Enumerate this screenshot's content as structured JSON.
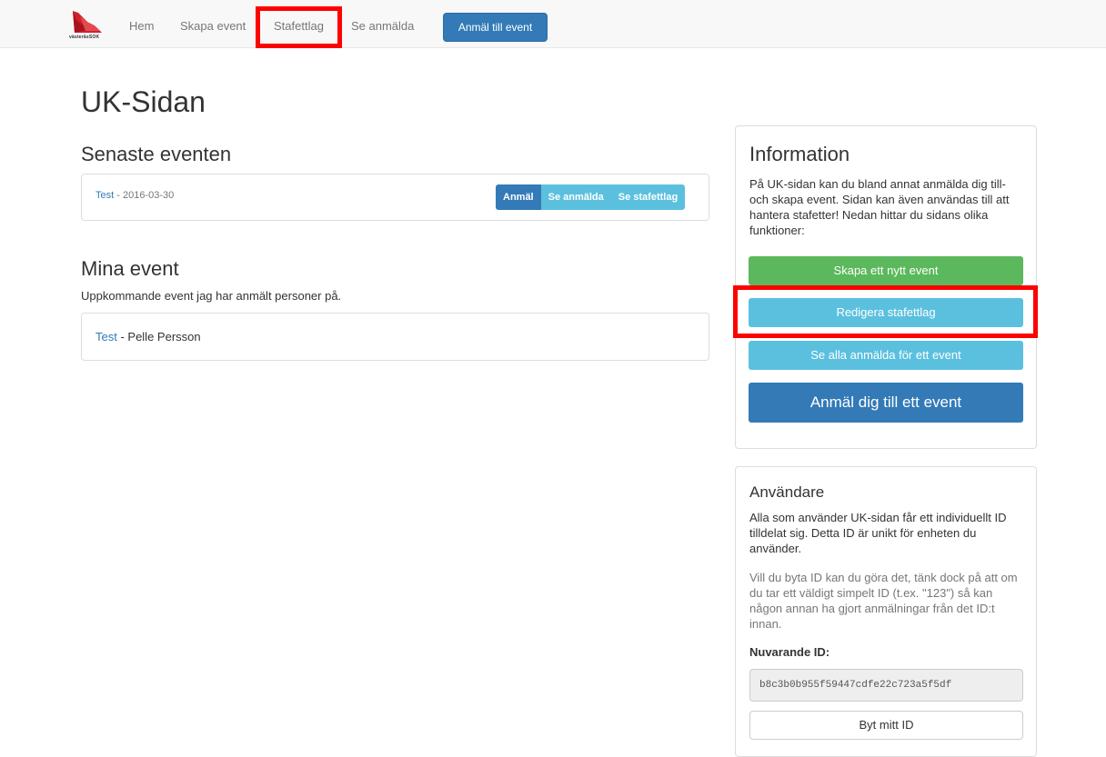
{
  "nav": {
    "logo_text": "västeråsSOK",
    "links": [
      "Hem",
      "Skapa event",
      "Stafettlag",
      "Se anmälda"
    ],
    "cta_label": "Anmäl till event"
  },
  "page_title": "UK-Sidan",
  "latest": {
    "heading": "Senaste eventen",
    "event_name": "Test",
    "event_date": " - 2016-03-30",
    "buttons": [
      "Anmäl",
      "Se anmälda",
      "Se stafettlag"
    ]
  },
  "my_events": {
    "heading": "Mina event",
    "description": "Uppkommande event jag har anmält personer på.",
    "item_link": "Test",
    "item_rest": " - Pelle Persson"
  },
  "info": {
    "heading": "Information",
    "text": "På UK-sidan kan du bland annat anmälda dig till- och skapa event. Sidan kan även användas till att hantera stafetter! Nedan hittar du sidans olika funktioner:",
    "btn_create": "Skapa ett nytt event",
    "btn_edit_relay": "Redigera stafettlag",
    "btn_see_all": "Se alla anmälda för ett event",
    "btn_register": "Anmäl dig till ett event"
  },
  "user": {
    "heading": "Användare",
    "text1": "Alla som använder UK-sidan får ett individuellt ID tilldelat sig. Detta ID är unikt för enheten du använder.",
    "text2": "Vill du byta ID kan du göra det, tänk dock på att om du tar ett väldigt simpelt ID (t.ex. \"123\") så kan någon annan ha gjort anmälningar från det ID:t innan.",
    "current_id_label": "Nuvarande ID:",
    "current_id": "b8c3b0b955f59447cdfe22c723a5f5df",
    "change_id_btn": "Byt mitt ID"
  },
  "colors": {
    "primary": "#337ab7",
    "info": "#5bc0de",
    "success": "#5cb85c",
    "highlight": "#ff0000"
  }
}
